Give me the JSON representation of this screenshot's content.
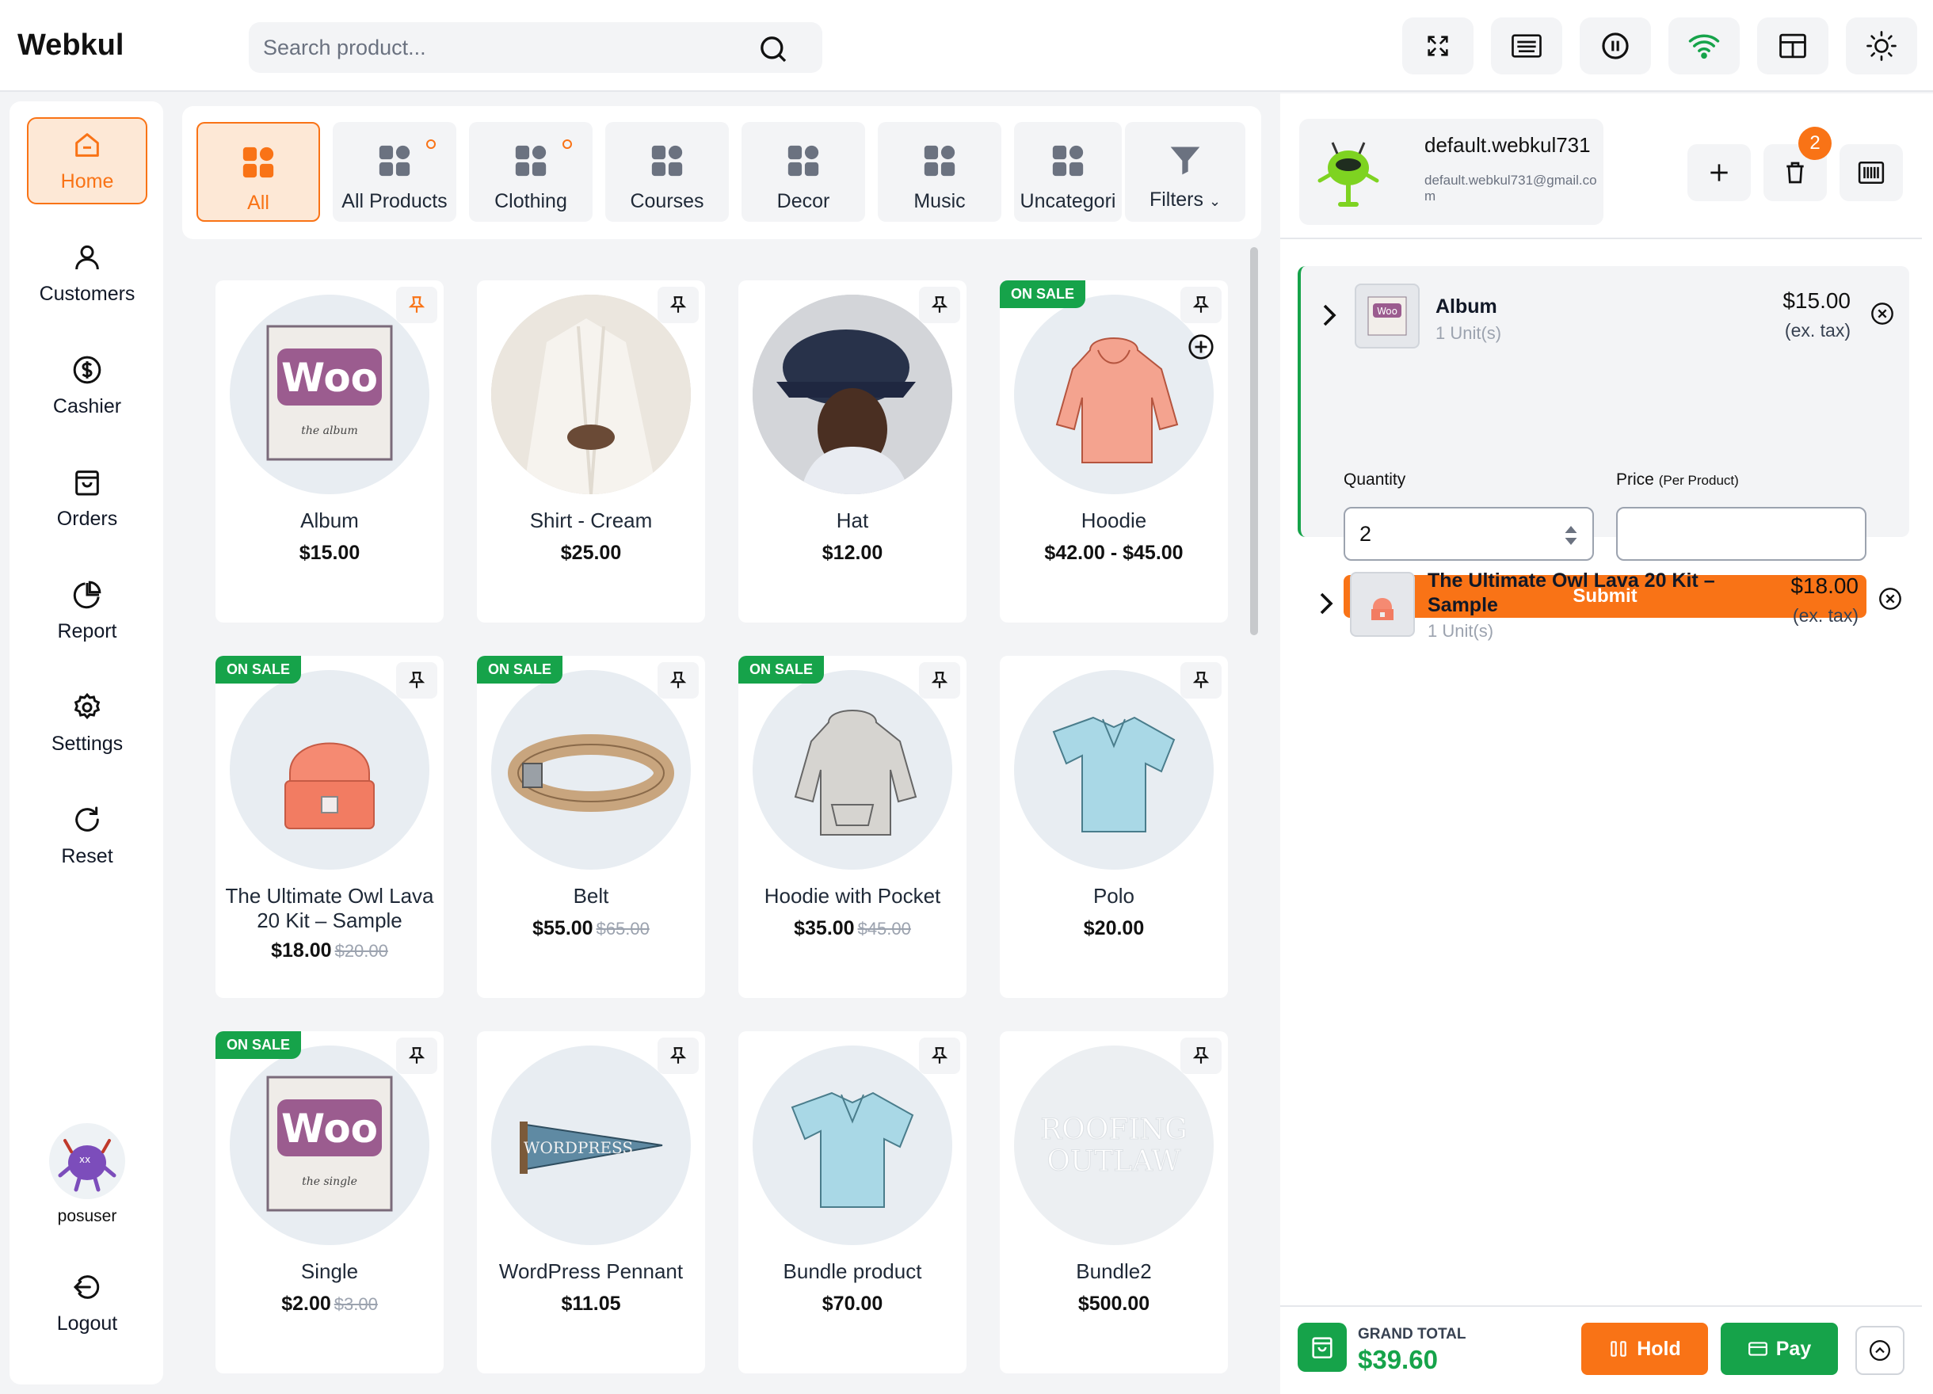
{
  "header": {
    "logo": "Webkul",
    "search_placeholder": "Search product...",
    "buttons": [
      "fullscreen-icon",
      "keyboard-icon",
      "pause-icon",
      "wifi-icon",
      "layout-icon",
      "sun-icon"
    ]
  },
  "sidebar": {
    "items": [
      {
        "label": "Home",
        "icon": "home-icon",
        "active": true
      },
      {
        "label": "Customers",
        "icon": "user-icon"
      },
      {
        "label": "Cashier",
        "icon": "dollar-icon"
      },
      {
        "label": "Orders",
        "icon": "bag-icon"
      },
      {
        "label": "Report",
        "icon": "pie-chart-icon"
      },
      {
        "label": "Settings",
        "icon": "gear-icon"
      },
      {
        "label": "Reset",
        "icon": "refresh-icon"
      }
    ],
    "user": {
      "name": "posuser"
    },
    "logout_label": "Logout"
  },
  "categories": [
    {
      "label": "All",
      "active": true
    },
    {
      "label": "All Products",
      "has_children": true
    },
    {
      "label": "Clothing",
      "has_children": true
    },
    {
      "label": "Courses"
    },
    {
      "label": "Decor"
    },
    {
      "label": "Music"
    },
    {
      "label": "Uncategori"
    },
    {
      "label": "Filters"
    }
  ],
  "products": [
    {
      "name": "Album",
      "price": "$15.00",
      "pinned": true
    },
    {
      "name": "Shirt - Cream",
      "price": "$25.00"
    },
    {
      "name": "Hat",
      "price": "$12.00"
    },
    {
      "name": "Hoodie",
      "price": "$42.00 - $45.00",
      "sale": "ON SALE"
    },
    {
      "name": "The Ultimate Owl Lava 20 Kit – Sample",
      "price": "$18.00",
      "old_price": "$20.00",
      "sale": "ON SALE"
    },
    {
      "name": "Belt",
      "price": "$55.00",
      "old_price": "$65.00",
      "sale": "ON SALE"
    },
    {
      "name": "Hoodie with Pocket",
      "price": "$35.00",
      "old_price": "$45.00",
      "sale": "ON SALE"
    },
    {
      "name": "Polo",
      "price": "$20.00"
    },
    {
      "name": "Single",
      "price": "$2.00",
      "old_price": "$3.00",
      "sale": "ON SALE"
    },
    {
      "name": "WordPress Pennant",
      "price": "$11.05"
    },
    {
      "name": "Bundle product",
      "price": "$70.00"
    },
    {
      "name": "Bundle2",
      "price": "$500.00"
    }
  ],
  "cart": {
    "customer": {
      "name": "default.webkul731",
      "email": "default.webkul731@gmail.com"
    },
    "badge_count": "2",
    "items": [
      {
        "name": "Album",
        "units": "1 Unit(s)",
        "price": "$15.00",
        "tax": "(ex. tax)"
      },
      {
        "name": "The Ultimate Owl Lava 20 Kit – Sample",
        "units": "1 Unit(s)",
        "price": "$18.00",
        "tax": "(ex. tax)"
      }
    ],
    "editor": {
      "quantity_label": "Quantity",
      "quantity_value": "2",
      "price_label": "Price",
      "price_hint": "(Per Product)",
      "price_value": "",
      "submit_label": "Submit"
    },
    "footer": {
      "grand_total_label": "GRAND TOTAL",
      "grand_total_value": "$39.60",
      "hold_label": "Hold",
      "pay_label": "Pay"
    }
  },
  "colors": {
    "accent": "#f97316",
    "success": "#16a34a"
  },
  "woo_art": {
    "woo": "Woo",
    "album_sub": "the album",
    "single_sub": "the single",
    "pennant": "WORDPRESS",
    "roofing": "ROOFING",
    "outlaw": "OUTLAW",
    "small_woo": "Woo"
  }
}
